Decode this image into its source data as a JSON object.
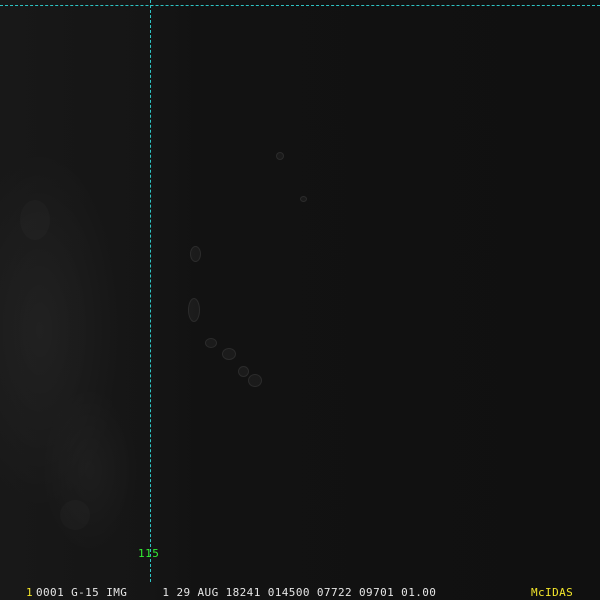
{
  "image": {
    "grid_color": "#2ec4c4",
    "background_color": "#101010"
  },
  "overlay": {
    "longitude_label": "115",
    "longitude_label_color": "#33ee33"
  },
  "status_bar": {
    "frame_number": "1",
    "info": "0001 G-15 IMG     1 29 AUG 18241 014500 07722 09701 01.00",
    "brand": "McIDAS",
    "text_color": "#e6e6e6",
    "accent_color": "#f2e52a"
  }
}
